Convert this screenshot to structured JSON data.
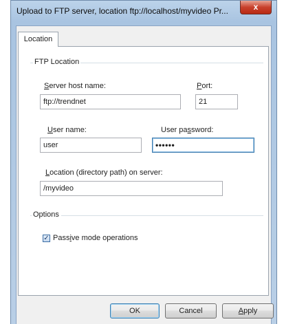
{
  "window": {
    "title": "Upload to FTP server, location ftp://localhost/myvideo Pr...",
    "close_label": "x"
  },
  "tab": {
    "label": "Location"
  },
  "ftp_group": {
    "title": "FTP Location",
    "host_label": "Server host name:",
    "host_value": "ftp://trendnet",
    "port_label": "Port:",
    "port_value": "21",
    "user_label": "User name:",
    "user_value": "user",
    "password_label": "User password:",
    "password_value": "••••••",
    "path_label": "Location (directory path) on server:",
    "path_value": "/myvideo"
  },
  "options_group": {
    "title": "Options",
    "passive_label": "Passive mode operations",
    "passive_checked": true,
    "check_mark": "✓"
  },
  "buttons": {
    "ok": "OK",
    "cancel": "Cancel",
    "apply": "Apply"
  }
}
